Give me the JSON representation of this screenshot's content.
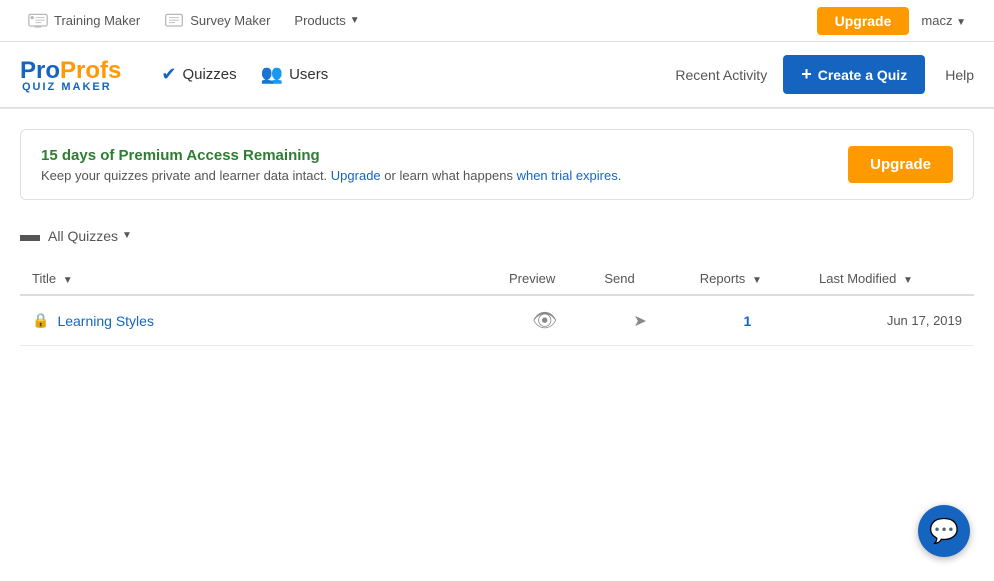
{
  "topnav": {
    "training_maker_label": "Training Maker",
    "survey_maker_label": "Survey Maker",
    "products_label": "Products",
    "upgrade_label": "Upgrade",
    "user_label": "macz"
  },
  "header": {
    "logo_pro": "Pro",
    "logo_profs": "Profs",
    "logo_sub": "Quiz Maker",
    "quizzes_label": "Quizzes",
    "users_label": "Users",
    "recent_activity_label": "Recent Activity",
    "create_quiz_label": "Create a Quiz",
    "help_label": "Help"
  },
  "banner": {
    "title": "15 days of Premium Access Remaining",
    "desc_before": "Keep your quizzes private and learner data intact.",
    "upgrade_link": "Upgrade",
    "desc_middle": "or learn what happens",
    "trial_link": "when trial expires.",
    "upgrade_btn": "Upgrade"
  },
  "quiz_list": {
    "folder_label": "All Quizzes",
    "columns": {
      "title": "Title",
      "preview": "Preview",
      "send": "Send",
      "reports": "Reports",
      "last_modified": "Last Modified"
    },
    "quizzes": [
      {
        "id": 1,
        "title": "Learning Styles",
        "locked": true,
        "preview_icon": "👁",
        "send_icon": "✈",
        "reports_count": "1",
        "last_modified": "Jun 17, 2019"
      }
    ]
  },
  "chat": {
    "icon": "💬"
  }
}
